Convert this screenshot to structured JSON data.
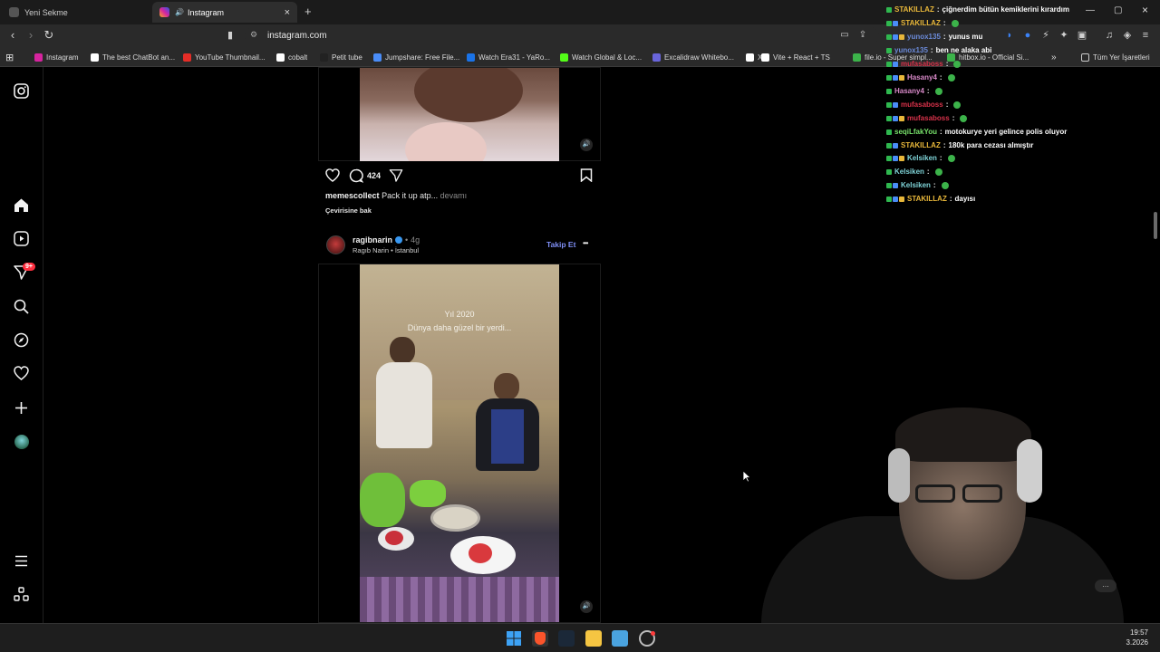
{
  "browser": {
    "tabs": [
      {
        "label": "Yeni Sekme"
      },
      {
        "label": "Instagram"
      }
    ],
    "new_tab_symbol": "+",
    "url": "instagram.com",
    "bookmarks": [
      {
        "label": "Instagram",
        "color": "#d6249f"
      },
      {
        "label": "The best ChatBot an...",
        "color": "#ffffff"
      },
      {
        "label": "YouTube Thumbnail...",
        "color": "#e52d27"
      },
      {
        "label": "cobalt",
        "color": "#ffffff"
      },
      {
        "label": "Petit tube",
        "color": "#222222"
      },
      {
        "label": "Jumpshare: Free File...",
        "color": "#4a8df8"
      },
      {
        "label": "Watch Era31 - YaRo...",
        "color": "#1a73e8"
      },
      {
        "label": "Watch Global & Loc...",
        "color": "#53fc18"
      },
      {
        "label": "Excalidraw Whitebo...",
        "color": "#6965db"
      },
      {
        "label": "X",
        "color": "#ffffff"
      },
      {
        "label": "Vite + React + TS",
        "color": "#ffffff"
      },
      {
        "label": "file.io - Super simpl...",
        "color": "#3cb34a"
      },
      {
        "label": "hitbox.io - Official Si...",
        "color": "#3cb34a"
      }
    ],
    "bookmarks_overflow": "»",
    "all_bookmarks": "Tüm Yer İşaretleri"
  },
  "post1": {
    "comment_count": "424",
    "username": "memescollect",
    "caption": "Pack it up atp...",
    "more": "devamı",
    "translate": "Çevirisine bak"
  },
  "post2": {
    "username": "ragibnarin",
    "time_sep": "•",
    "time": "4g",
    "subtitle": "Ragıb Narin • İstanbul",
    "follow": "Takip Et",
    "more_menu": "•••",
    "video_text_line1": "Yıl 2020",
    "video_text_line2": "Dünya daha güzel bir yerdi..."
  },
  "sidebar": {
    "notification_badge": "9+"
  },
  "chat": [
    {
      "user": "STAKILLAZ",
      "color": "#e8b73a",
      "message": "çiğnerdim bütün kemiklerini kırardım",
      "emote": false
    },
    {
      "user": "STAKILLAZ",
      "color": "#e8b73a",
      "message": "",
      "emote": true
    },
    {
      "user": "yunox135",
      "color": "#6b8ad8",
      "message": "yunus mu",
      "emote": false
    },
    {
      "user": "yunox135",
      "color": "#6b8ad8",
      "message": "ben ne alaka abi",
      "emote": false
    },
    {
      "user": "mufasaboss",
      "color": "#d8324a",
      "message": "",
      "emote": true
    },
    {
      "user": "Hasany4",
      "color": "#d889c8",
      "message": "",
      "emote": true
    },
    {
      "user": "Hasany4",
      "color": "#d889c8",
      "message": "",
      "emote": true
    },
    {
      "user": "mufasaboss",
      "color": "#d8324a",
      "message": "",
      "emote": true
    },
    {
      "user": "mufasaboss",
      "color": "#d8324a",
      "message": "",
      "emote": true
    },
    {
      "user": "seqiLfakYou",
      "color": "#78e26b",
      "message": "motokurye yeri gelince polis oluyor",
      "emote": false
    },
    {
      "user": "STAKILLAZ",
      "color": "#e8b73a",
      "message": "180k para cezası almıştır",
      "emote": false
    },
    {
      "user": "Kelsiken",
      "color": "#7fd4d8",
      "message": "",
      "emote": true
    },
    {
      "user": "Kelsiken",
      "color": "#7fd4d8",
      "message": "",
      "emote": true
    },
    {
      "user": "Kelsiken",
      "color": "#7fd4d8",
      "message": "",
      "emote": true
    },
    {
      "user": "STAKILLAZ",
      "color": "#e8b73a",
      "message": "dayısı",
      "emote": false
    }
  ],
  "chat_separator": ":",
  "clock": {
    "time": "19:57",
    "date": "3.2026"
  },
  "colors": {
    "accent_follow": "#7f8ff6",
    "background": "#000000",
    "badge": "#ff3040"
  }
}
